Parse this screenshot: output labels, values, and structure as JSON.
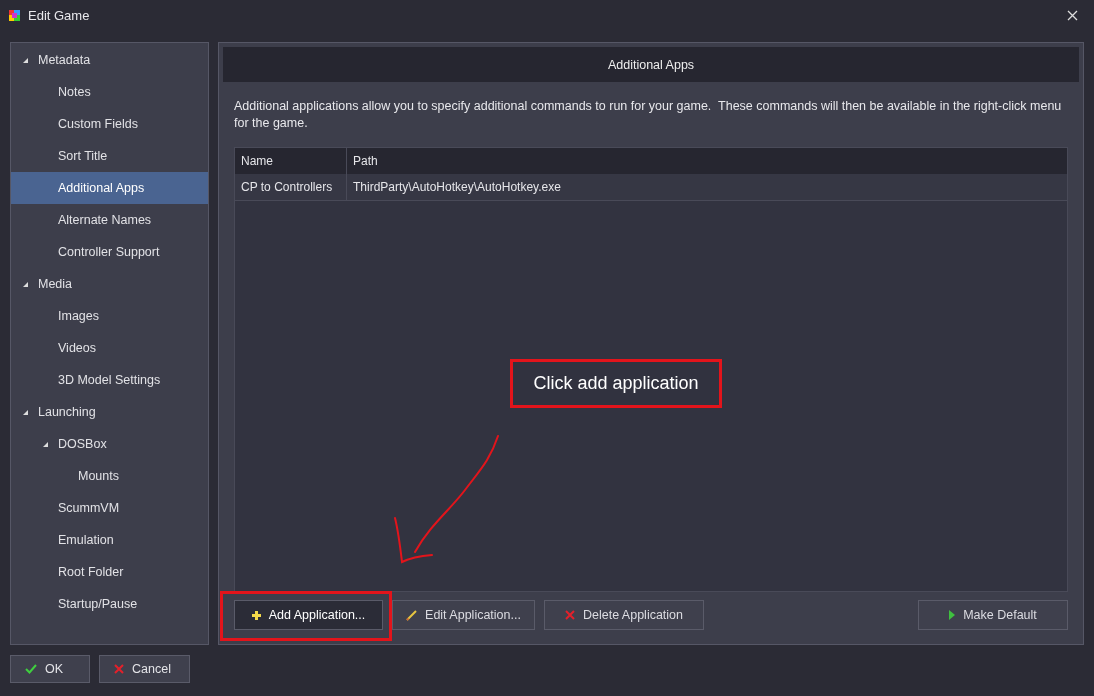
{
  "window": {
    "title": "Edit Game"
  },
  "sidebar": {
    "items": [
      {
        "label": "Metadata",
        "expanded": true,
        "selected": false,
        "children": [
          {
            "label": "Notes",
            "selected": false
          },
          {
            "label": "Custom Fields",
            "selected": false
          },
          {
            "label": "Sort Title",
            "selected": false
          },
          {
            "label": "Additional Apps",
            "selected": true
          },
          {
            "label": "Alternate Names",
            "selected": false
          },
          {
            "label": "Controller Support",
            "selected": false
          }
        ]
      },
      {
        "label": "Media",
        "expanded": true,
        "selected": false,
        "children": [
          {
            "label": "Images",
            "selected": false
          },
          {
            "label": "Videos",
            "selected": false
          },
          {
            "label": "3D Model Settings",
            "selected": false
          }
        ]
      },
      {
        "label": "Launching",
        "expanded": true,
        "selected": false,
        "children": [
          {
            "label": "DOSBox",
            "expanded": true,
            "selected": false,
            "children": [
              {
                "label": "Mounts",
                "selected": false
              }
            ]
          },
          {
            "label": "ScummVM",
            "selected": false
          },
          {
            "label": "Emulation",
            "selected": false
          },
          {
            "label": "Root Folder",
            "selected": false
          },
          {
            "label": "Startup/Pause",
            "selected": false
          }
        ]
      }
    ]
  },
  "panel": {
    "title": "Additional Apps",
    "description": "Additional applications allow you to specify additional commands to run for your game.  These commands will then be available in the right-click menu for the game.",
    "table": {
      "columns": [
        "Name",
        "Path"
      ],
      "rows": [
        [
          "CP to Controllers",
          "ThirdParty\\AutoHotkey\\AutoHotkey.exe"
        ]
      ]
    },
    "buttons": [
      {
        "label": "Add Application...",
        "kind": "add",
        "focused": true
      },
      {
        "label": "Edit Application...",
        "kind": "edit",
        "focused": false
      },
      {
        "label": "Delete Application",
        "kind": "delete",
        "focused": false
      },
      {
        "label": "Make Default",
        "kind": "default",
        "focused": false
      }
    ]
  },
  "annotation": {
    "callout": "Click add application"
  },
  "footer_buttons": [
    {
      "label": "OK",
      "kind": "ok"
    },
    {
      "label": "Cancel",
      "kind": "cancel"
    }
  ]
}
